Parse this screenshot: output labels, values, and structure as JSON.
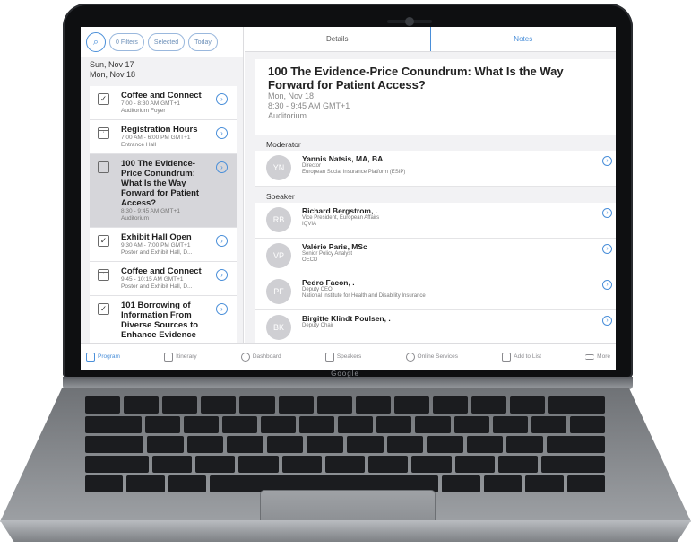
{
  "filters": [
    "0 Filters",
    "Selected",
    "Today"
  ],
  "days": [
    "Sun, Nov 17",
    "Mon, Nov 18"
  ],
  "sessions": [
    {
      "title": "Coffee and Connect",
      "sub": "7:00 - 8:30 AM GMT+1",
      "sub2": "Auditorium Foyer",
      "icon": "checkbox"
    },
    {
      "title": "Registration Hours",
      "sub": "7:00 AM - 6:00 PM GMT+1",
      "sub2": "Entrance Hall",
      "icon": "calendar"
    },
    {
      "title": "100 The Evidence-Price Conundrum: What Is the Way Forward for Patient Access?",
      "sub": "8:30 - 9:45 AM GMT+1",
      "sub2": "Auditorium",
      "icon": "checkbox",
      "selected": true
    },
    {
      "title": "Exhibit Hall Open",
      "sub": "9:30 AM - 7:00 PM GMT+1",
      "sub2": "Poster and Exhibit Hall, D...",
      "icon": "checkbox"
    },
    {
      "title": "Coffee and Connect",
      "sub": "9:45 - 10:15 AM GMT+1",
      "sub2": "Poster and Exhibit Hall, D...",
      "icon": "calendar"
    },
    {
      "title": "101 Borrowing of Information From Diverse Sources to Enhance Evidence",
      "sub": "",
      "sub2": "",
      "icon": "checkbox"
    }
  ],
  "tabs": {
    "details": "Details",
    "notes": "Notes"
  },
  "detail": {
    "title": "100 The Evidence-Price Conundrum: What Is the Way Forward for Patient Access?",
    "day": "Mon, Nov 18",
    "time": "8:30 - 9:45 AM GMT+1",
    "location": "Auditorium"
  },
  "moderator_label": "Moderator",
  "moderator": {
    "initials": "YN",
    "name": "Yannis Natsis, MA, BA",
    "role": "Director",
    "org": "European Social Insurance Platform (ESIP)"
  },
  "speaker_label": "Speaker",
  "speakers": [
    {
      "initials": "RB",
      "name": "Richard Bergstrom, .",
      "role": "Vice President, European Affairs",
      "org": "IQVIA"
    },
    {
      "initials": "VP",
      "name": "Valérie Paris, MSc",
      "role": "Senior Policy Analyst",
      "org": "OECD"
    },
    {
      "initials": "PF",
      "name": "Pedro Facon, .",
      "role": "Deputy CEO",
      "org": "National Institute for Health and Disability Insurance"
    },
    {
      "initials": "BK",
      "name": "Birgitte Klindt Poulsen, .",
      "role": "Deputy Chair",
      "org": ""
    }
  ],
  "nav": [
    {
      "label": "Program",
      "active": true
    },
    {
      "label": "Itinerary"
    },
    {
      "label": "Dashboard"
    },
    {
      "label": "Speakers"
    },
    {
      "label": "Online Services"
    },
    {
      "label": "Add to List"
    },
    {
      "label": "More"
    }
  ],
  "brand": "Google",
  "colors": {
    "accent": "#4a8fd9",
    "selected_row": "#d6d6da",
    "panel_bg": "#f2f2f4"
  }
}
